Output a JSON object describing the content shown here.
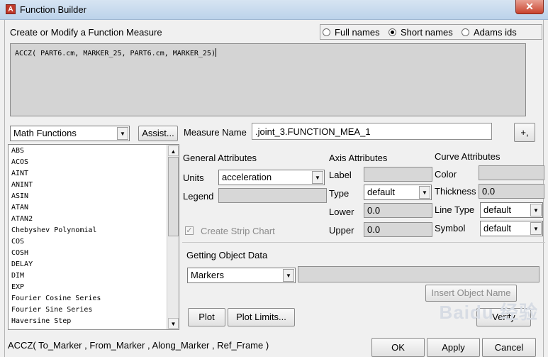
{
  "window": {
    "icon_letter": "A",
    "title": "Function Builder",
    "close_glyph": "✕"
  },
  "header": {
    "heading": "Create or Modify a Function Measure",
    "name_mode": {
      "options": [
        "Full names",
        "Short names",
        "Adams ids"
      ],
      "selected": "Short names"
    }
  },
  "expression": "ACCZ( PART6.cm, MARKER_25, PART6.cm, MARKER_25)",
  "function_category": {
    "selected": "Math Functions",
    "assist_label": "Assist..."
  },
  "function_list": [
    "ABS",
    "ACOS",
    "AINT",
    "ANINT",
    "ASIN",
    "ATAN",
    "ATAN2",
    "Chebyshev Polynomial",
    "COS",
    "COSH",
    "DELAY",
    "DIM",
    "EXP",
    "Fourier Cosine Series",
    "Fourier Sine Series",
    "Haversine Step"
  ],
  "measure": {
    "label": "Measure Name",
    "value": ".joint_3.FUNCTION_MEA_1",
    "more_button": "+,"
  },
  "general_attributes": {
    "heading": "General Attributes",
    "units_label": "Units",
    "units_value": "acceleration",
    "legend_label": "Legend",
    "legend_value": "",
    "strip_chart_label": "Create Strip Chart",
    "strip_chart_checked": true
  },
  "axis_attributes": {
    "heading": "Axis Attributes",
    "label_label": "Label",
    "label_value": "",
    "type_label": "Type",
    "type_value": "default",
    "lower_label": "Lower",
    "lower_value": "0.0",
    "upper_label": "Upper",
    "upper_value": "0.0"
  },
  "curve_attributes": {
    "heading": "Curve Attributes",
    "color_label": "Color",
    "color_value": "",
    "thickness_label": "Thickness",
    "thickness_value": "0.0",
    "line_type_label": "Line Type",
    "line_type_value": "default",
    "symbol_label": "Symbol",
    "symbol_value": "default"
  },
  "object_data": {
    "heading": "Getting Object Data",
    "selected": "Markers",
    "value": "",
    "insert_label": "Insert Object Name"
  },
  "buttons": {
    "plot": "Plot",
    "plot_limits": "Plot Limits...",
    "verify": "Verify",
    "ok": "OK",
    "apply": "Apply",
    "cancel": "Cancel"
  },
  "signature": "ACCZ( To_Marker , From_Marker , Along_Marker , Ref_Frame )",
  "watermark": "Baidu 经验",
  "colors": {
    "panel_bg": "#f0f0f0",
    "titlebar": "#c8d9ec",
    "close": "#c9432e",
    "field_disabled": "#d7d7d7"
  }
}
